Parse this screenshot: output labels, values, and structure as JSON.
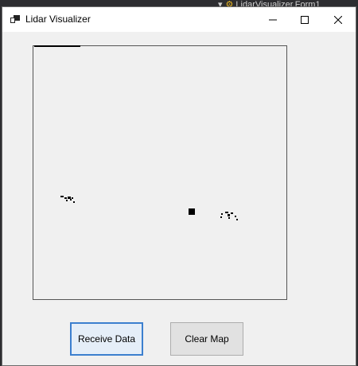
{
  "window": {
    "title": "Lidar Visualizer",
    "app_icon": "app-window-icon",
    "controls": {
      "minimize": "−",
      "maximize": "☐",
      "close": "✕"
    }
  },
  "background_ide": {
    "tab_label": "LidarVisualizer.Form1"
  },
  "map": {
    "robot_marker": "robot-position-marker"
  },
  "buttons": {
    "receive_label": "Receive Data",
    "clear_label": "Clear Map"
  },
  "colors": {
    "focus_border": "#3c7fcf",
    "button_bg": "#e1e1e1",
    "window_bg": "#f0f0f0"
  }
}
